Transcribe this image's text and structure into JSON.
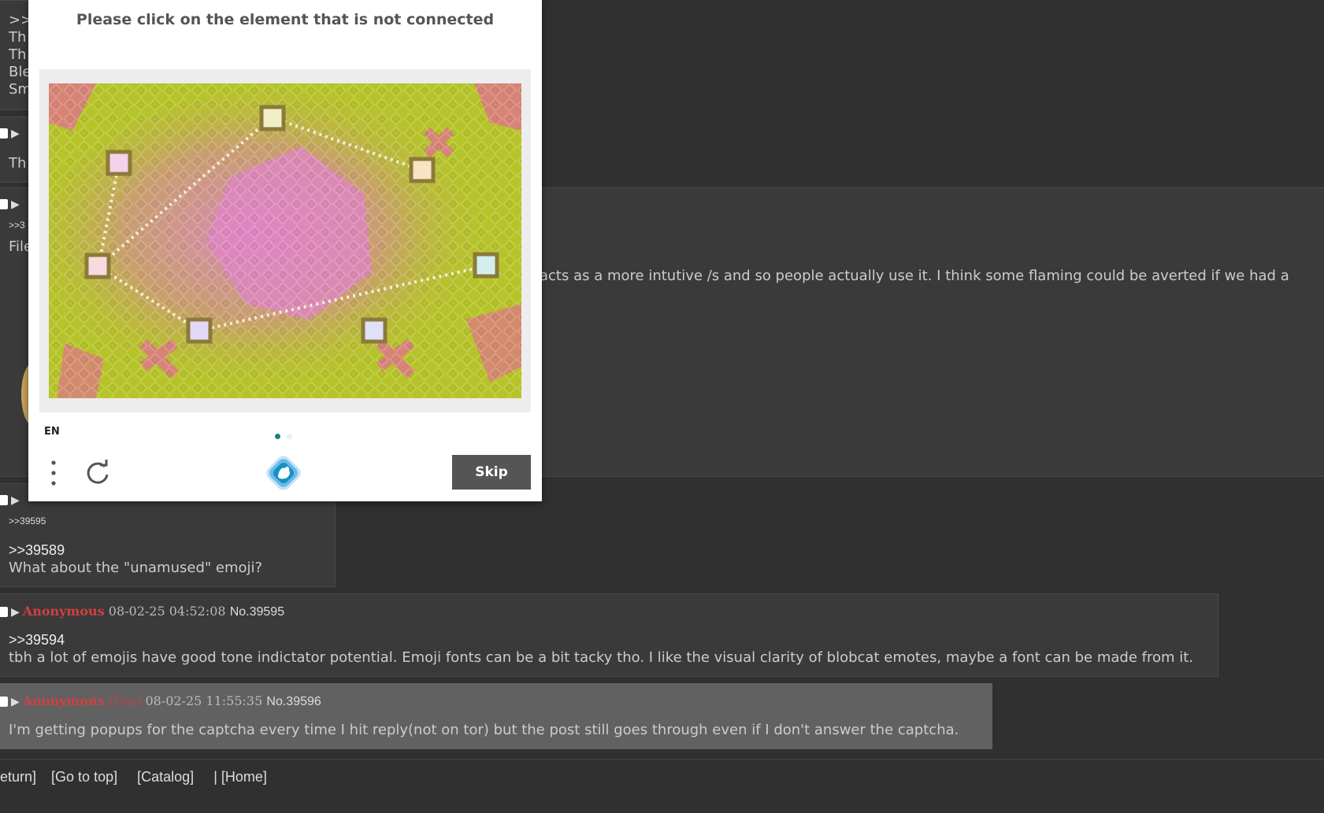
{
  "captcha": {
    "title": "Please click on the element that is not connected",
    "language": "EN",
    "skip_label": "Skip",
    "menu_icon": "vertical-dots-icon",
    "refresh_icon": "refresh-icon",
    "logo_icon": "hcaptcha-logo-icon",
    "accent_color": "#1d7f86"
  },
  "background_fragments": {
    "top_left_lines": [
      ">>",
      "Th",
      "Th",
      "Ble",
      "Sm"
    ],
    "post2_body": "Th",
    "post3_ref": ">>3",
    "post3_file": "File",
    "long_text": "acts as a more intutive /s and so people actually use it. I think some flaming could be averted if we had a"
  },
  "posts": [
    {
      "ref": ">>39595",
      "quote": ">>39589",
      "text": "What about the \"unamused\" emoji?"
    },
    {
      "name": "Anonymous",
      "date": "08-02-25 04:52:08",
      "number": "No.39595",
      "quote": ">>39594",
      "text": "tbh a lot of emojis have good tone indictator potential. Emoji fonts can be a bit tacky tho. I like the visual clarity of blobcat emotes, maybe a font can be made from it."
    },
    {
      "name": "Anonymous",
      "you": "(You)",
      "date": "08-02-25 11:55:35",
      "number": "No.39596",
      "text": "I'm getting popups for the captcha every time I hit reply(not on tor) but the post still goes through even if I don't answer the captcha."
    }
  ],
  "footer": {
    "links": [
      "eturn]",
      "[Go to top]",
      "[Catalog]",
      "| [Home]"
    ]
  },
  "colors": {
    "background": "#303030",
    "post_bg": "#3a3a3a",
    "own_post_bg": "#616161",
    "name_red": "#d33f3f"
  }
}
